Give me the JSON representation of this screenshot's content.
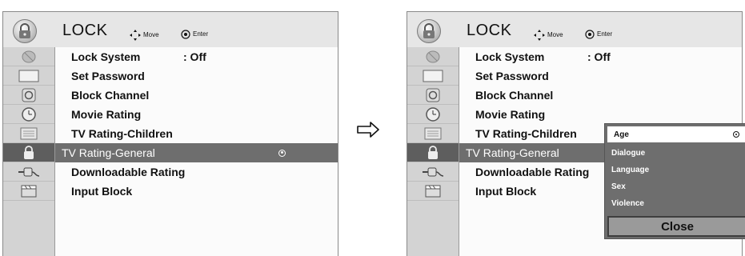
{
  "menu": {
    "title": "LOCK",
    "hint_move": "Move",
    "hint_enter": "Enter",
    "sidebar_icons": [
      "satellite-dish-icon",
      "screen-icon",
      "speaker-icon",
      "clock-icon",
      "picture-icon",
      "lock-icon",
      "plug-icon",
      "clapperboard-icon"
    ],
    "items": [
      {
        "label": "Lock System",
        "value": ": Off"
      },
      {
        "label": "Set Password",
        "value": ""
      },
      {
        "label": "Block Channel",
        "value": ""
      },
      {
        "label": "Movie Rating",
        "value": ""
      },
      {
        "label": "TV Rating-Children",
        "value": ""
      },
      {
        "label": "TV Rating-General",
        "value": ""
      },
      {
        "label": "Downloadable Rating",
        "value": ""
      },
      {
        "label": "Input Block",
        "value": ""
      }
    ],
    "selected_item": "TV Rating-General"
  },
  "popup": {
    "items": [
      "Age",
      "Dialogue",
      "Language",
      "Sex",
      "Violence"
    ],
    "selected": "Age",
    "close_label": "Close"
  },
  "colors": {
    "highlight": "#6e6e6e",
    "sidebar": "#d3d3d3",
    "content_bg": "#fbfbfb"
  }
}
